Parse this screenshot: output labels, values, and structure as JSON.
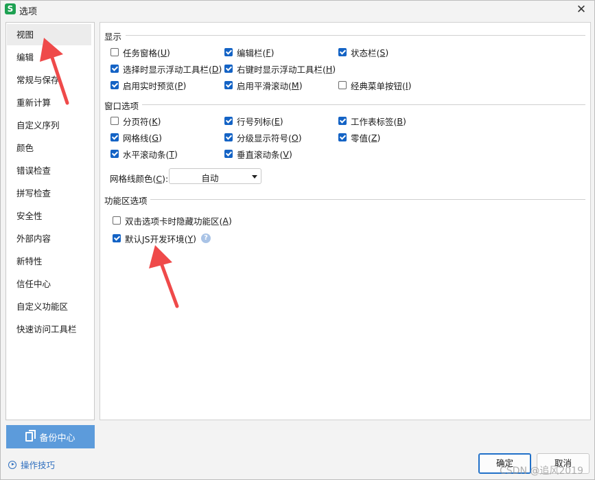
{
  "window": {
    "title": "选项",
    "app_icon": "S",
    "close": "✕"
  },
  "sidebar": {
    "items": [
      {
        "label": "视图",
        "active": true
      },
      {
        "label": "编辑"
      },
      {
        "label": "常规与保存"
      },
      {
        "label": "重新计算"
      },
      {
        "label": "自定义序列"
      },
      {
        "label": "颜色"
      },
      {
        "label": "错误检查"
      },
      {
        "label": "拼写检查"
      },
      {
        "label": "安全性"
      },
      {
        "label": "外部内容"
      },
      {
        "label": "新特性"
      },
      {
        "label": "信任中心"
      },
      {
        "label": "自定义功能区"
      },
      {
        "label": "快速访问工具栏"
      }
    ]
  },
  "display": {
    "title": "显示",
    "options": [
      {
        "label": "任务窗格(",
        "key": "U",
        "checked": false
      },
      {
        "label": "编辑栏(",
        "key": "F",
        "checked": true
      },
      {
        "label": "状态栏(",
        "key": "S",
        "checked": true
      },
      {
        "label": "选择时显示浮动工具栏(",
        "key": "D",
        "checked": true
      },
      {
        "label": "右键时显示浮动工具栏(",
        "key": "H",
        "checked": true
      },
      {
        "label": "启用实时预览(",
        "key": "P",
        "checked": true
      },
      {
        "label": "启用平滑滚动(",
        "key": "M",
        "checked": true
      },
      {
        "label": "经典菜单按钮(",
        "key": "I",
        "checked": false
      }
    ]
  },
  "window_options": {
    "title": "窗口选项",
    "options": [
      {
        "label": "分页符(",
        "key": "K",
        "checked": false
      },
      {
        "label": "行号列标(",
        "key": "E",
        "checked": true
      },
      {
        "label": "工作表标签(",
        "key": "B",
        "checked": true
      },
      {
        "label": "网格线(",
        "key": "G",
        "checked": true
      },
      {
        "label": "分级显示符号(",
        "key": "O",
        "checked": true
      },
      {
        "label": "零值(",
        "key": "Z",
        "checked": true
      },
      {
        "label": "水平滚动条(",
        "key": "T",
        "checked": true
      },
      {
        "label": "垂直滚动条(",
        "key": "V",
        "checked": true
      }
    ],
    "gridline_color_label": "网格线颜色(",
    "gridline_color_key": "C",
    "gridline_color_suffix": "):",
    "gridline_color_value": "自动"
  },
  "ribbon": {
    "title": "功能区选项",
    "options": [
      {
        "label": "双击选项卡时隐藏功能区(",
        "key": "A",
        "checked": false
      },
      {
        "label": "默认JS开发环境(",
        "key": "Y",
        "checked": true
      }
    ],
    "help": "?"
  },
  "close_paren": ")",
  "footer": {
    "backup_label": "备份中心",
    "tips_label": "操作技巧",
    "ok_label": "确定",
    "cancel_label": "取消"
  },
  "watermark": "CSDN @追风2019",
  "colors": {
    "accent": "#1463c5",
    "backup": "#5c9bdb",
    "link": "#2f6fbf",
    "arrow": "#ef4a4a"
  }
}
